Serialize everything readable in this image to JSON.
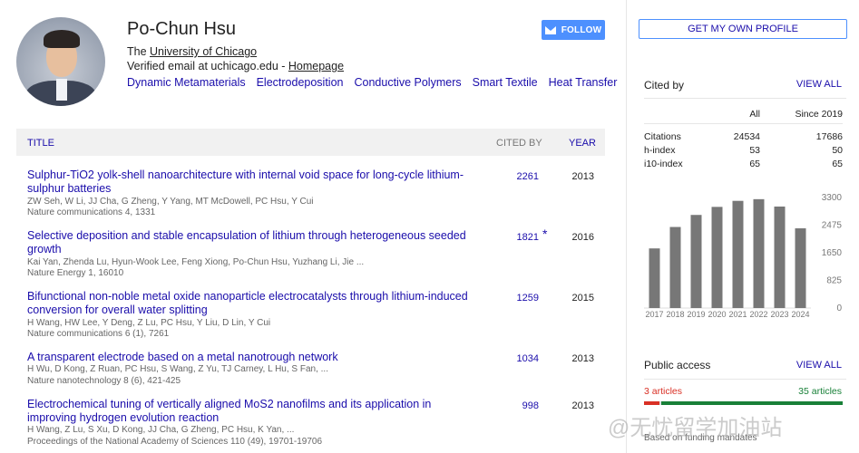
{
  "profile": {
    "name": "Po-Chun Hsu",
    "affiliation_prefix": "The ",
    "affiliation": "University of Chicago",
    "email": "Verified email at uchicago.edu - ",
    "homepage": "Homepage",
    "interests": [
      "Dynamic Metamaterials",
      "Electrodeposition",
      "Conductive Polymers",
      "Smart Textile",
      "Heat Transfer"
    ],
    "follow_label": "FOLLOW"
  },
  "table": {
    "col_title": "TITLE",
    "col_cited_by": "CITED BY",
    "col_year": "YEAR",
    "rows": [
      {
        "title": "Sulphur-TiO2 yolk-shell nanoarchitecture with internal void space for long-cycle lithium-sulphur batteries",
        "authors": "ZW Seh, W Li, JJ Cha, G Zheng, Y Yang, MT McDowell, PC Hsu, Y Cui",
        "venue": "Nature communications 4, 1331",
        "cited_by": "2261",
        "star": "",
        "year": "2013"
      },
      {
        "title": "Selective deposition and stable encapsulation of lithium through heterogeneous seeded growth",
        "authors": "Kai Yan, Zhenda Lu, Hyun-Wook Lee, Feng Xiong, Po-Chun Hsu, Yuzhang Li, Jie ...",
        "venue": "Nature Energy 1, 16010",
        "cited_by": "1821",
        "star": "*",
        "year": "2016"
      },
      {
        "title": "Bifunctional non-noble metal oxide nanoparticle electrocatalysts through lithium-induced conversion for overall water splitting",
        "authors": "H Wang, HW Lee, Y Deng, Z Lu, PC Hsu, Y Liu, D Lin, Y Cui",
        "venue": "Nature communications 6 (1), 7261",
        "cited_by": "1259",
        "star": "",
        "year": "2015"
      },
      {
        "title": "A transparent electrode based on a metal nanotrough network",
        "authors": "H Wu, D Kong, Z Ruan, PC Hsu, S Wang, Z Yu, TJ Carney, L Hu, S Fan, ...",
        "venue": "Nature nanotechnology 8 (6), 421-425",
        "cited_by": "1034",
        "star": "",
        "year": "2013"
      },
      {
        "title": "Electrochemical tuning of vertically aligned MoS2 nanofilms and its application in improving hydrogen evolution reaction",
        "authors": "H Wang, Z Lu, S Xu, D Kong, JJ Cha, G Zheng, PC Hsu, K Yan, ...",
        "venue": "Proceedings of the National Academy of Sciences 110 (49), 19701-19706",
        "cited_by": "998",
        "star": "",
        "year": "2013"
      }
    ]
  },
  "sidebar": {
    "get_profile": "GET MY OWN PROFILE",
    "cited_by_title": "Cited by",
    "view_all": "VIEW ALL",
    "stats_head": [
      "",
      "All",
      "Since 2019"
    ],
    "stats": [
      {
        "label": "Citations",
        "all": "24534",
        "since": "17686"
      },
      {
        "label": "h-index",
        "all": "53",
        "since": "50"
      },
      {
        "label": "i10-index",
        "all": "65",
        "since": "65"
      }
    ],
    "public_access_title": "Public access",
    "public_view_all": "VIEW ALL",
    "not_available": "3 articles",
    "available": "35 articles",
    "based_on": "Based on funding mandates",
    "public_access_split": {
      "not_available": 3,
      "available": 35
    },
    "watermark": "@无忧留学加油站"
  },
  "chart_data": {
    "type": "bar",
    "categories": [
      "2017",
      "2018",
      "2019",
      "2020",
      "2021",
      "2022",
      "2023",
      "2024"
    ],
    "values": [
      1780,
      2420,
      2780,
      3020,
      3200,
      3250,
      3030,
      2380
    ],
    "yticks": [
      "3300",
      "2475",
      "1650",
      "825",
      "0"
    ],
    "ylim": [
      0,
      3300
    ],
    "bar_color": "#777777"
  }
}
